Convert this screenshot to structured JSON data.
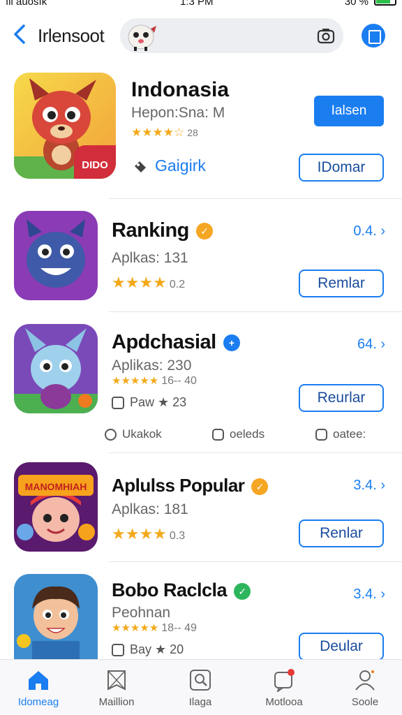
{
  "status_bar": {
    "carrier": "ıll auosık",
    "time": "1:3 PM",
    "battery": "30 %"
  },
  "nav": {
    "title": "Irlensoot",
    "search_placeholder": ""
  },
  "featured": {
    "name": "Indonasia",
    "subtitle": "Hepon:Sna: M",
    "stars": "★★★★☆",
    "rating": "28",
    "link_label": "Gaigirk",
    "primary_button": "Ialsen",
    "secondary_button": "IDomar",
    "icon_badge": "DIDO"
  },
  "apps": [
    {
      "name": "Ranking",
      "badge": "gold",
      "subtitle": "Aplkas: 131",
      "stars": "★★★★",
      "rating": "0.2",
      "price": "0.4. ›",
      "button": "Remlar"
    },
    {
      "name": "Apdchasial",
      "badge": "blue",
      "subtitle": "Aplikas: 230",
      "stars": "★★★★★",
      "rating": "16-- 40",
      "extra": "Paw ★ 23",
      "price": "64. ›",
      "button": "Reurlar"
    },
    {
      "name": "Aplulss Popular",
      "badge": "gold",
      "subtitle": "Aplkas: 181",
      "stars": "★★★★",
      "rating": "0.3",
      "price": "3.4. ›",
      "button": "Renlar"
    },
    {
      "name": "Bobo Raclcla",
      "badge": "green",
      "subtitle": "Peohnan",
      "stars": "★★★★★",
      "rating": "18-- 49",
      "extra": "Bay ★ 20",
      "price": "3.4. ›",
      "button": "Deular"
    }
  ],
  "meta_row": {
    "item1": "Ukakok",
    "item2": "oeleds",
    "item3": "oatee:"
  },
  "icon_banner": "MANOMHIAH",
  "tabs": [
    {
      "label": "Idomeag",
      "icon": "home-icon",
      "active": true
    },
    {
      "label": "Maillion",
      "icon": "flag-icon",
      "active": false
    },
    {
      "label": "Ilaga",
      "icon": "search-icon",
      "active": false
    },
    {
      "label": "Motlooa",
      "icon": "notification-icon",
      "active": false
    },
    {
      "label": "Soole",
      "icon": "profile-icon",
      "active": false
    }
  ],
  "colors": {
    "accent": "#1a7df0",
    "star": "#f3a91b"
  }
}
